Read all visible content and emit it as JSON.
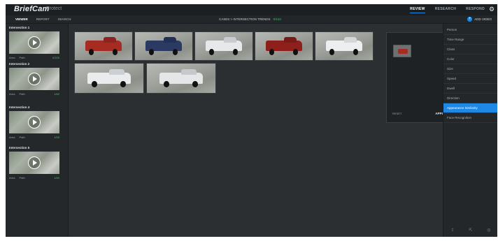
{
  "header": {
    "brand": "BriefCam",
    "brand_sub": "Protect",
    "nav": [
      "REVIEW",
      "RESEARCH",
      "RESPOND"
    ],
    "active_nav": "REVIEW",
    "settings_icon": "gear-icon"
  },
  "subbar": {
    "tabs": [
      "VIEWER",
      "REPORT",
      "SEARCH"
    ],
    "active_tab": "VIEWER",
    "breadcrumb": "CASES > INTERSECTION TRENDS",
    "breadcrumb_extra": "0/104",
    "add_video": "ADD VIDEO"
  },
  "videos": [
    {
      "title": "Intersection 1",
      "area": "Area",
      "path": "Path",
      "size": "0/225"
    },
    {
      "title": "Intersection 2",
      "area": "Area",
      "path": "Path",
      "size": "1/82"
    },
    {
      "title": "Intersection 4",
      "area": "Area",
      "path": "Path",
      "size": "1/59"
    },
    {
      "title": "Intersection 5",
      "area": "Area",
      "path": "Path",
      "size": "1/80"
    }
  ],
  "popup": {
    "reset": "RESET",
    "apply": "APPLY"
  },
  "filters": [
    "Person",
    "Time Range",
    "Class",
    "Color",
    "Size",
    "Speed",
    "Dwell",
    "Direction",
    "Appearance Similarity",
    "Face Recognition"
  ],
  "active_filter": "Appearance Similarity",
  "colors": {
    "accent": "#1e88e5",
    "status_green": "#35c759",
    "truck_red": "#a52b23",
    "truck_blue": "#2b3a63",
    "truck_white": "#e6e8ea"
  }
}
